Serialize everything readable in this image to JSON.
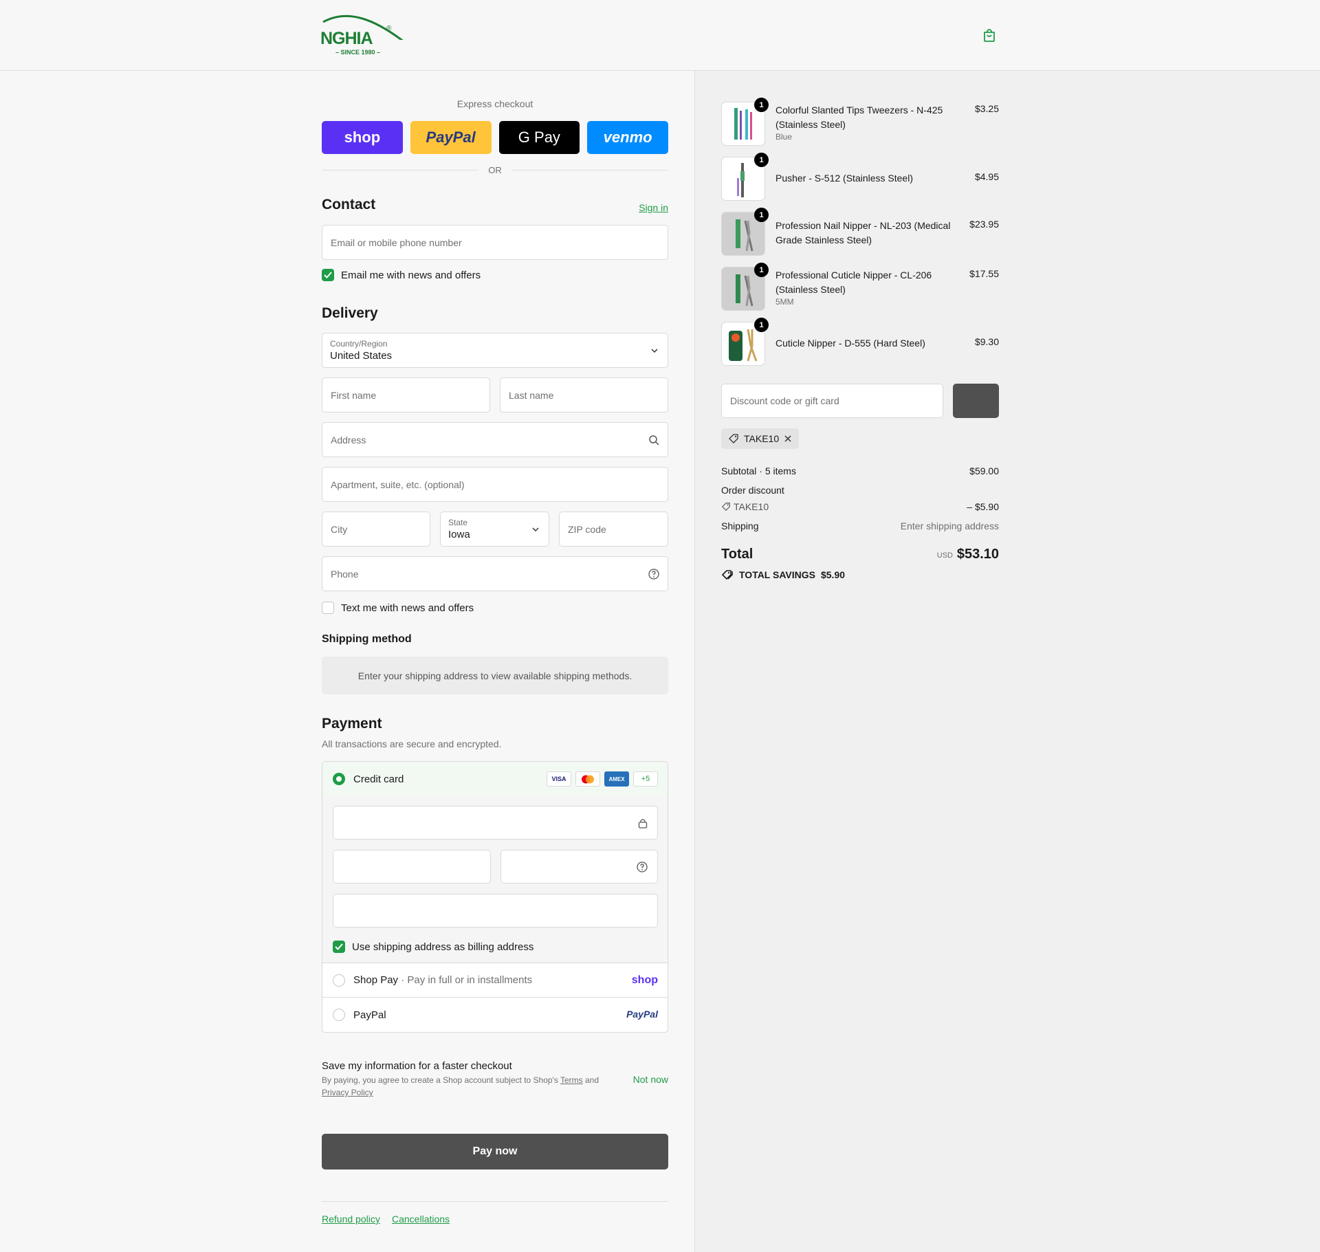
{
  "brand": {
    "logo_text": "NGHIA",
    "since": "– SINCE 1980 –",
    "reg": "®"
  },
  "express": {
    "title": "Express checkout",
    "buttons": [
      "shop",
      "PayPal",
      "G Pay",
      "venmo"
    ],
    "or": "OR"
  },
  "contact": {
    "title": "Contact",
    "sign_in": "Sign in",
    "email_placeholder": "Email or mobile phone number",
    "news_label": "Email me with news and offers"
  },
  "delivery": {
    "title": "Delivery",
    "country_label": "Country/Region",
    "country_value": "United States",
    "first_name": "First name",
    "last_name": "Last name",
    "address": "Address",
    "apartment": "Apartment, suite, etc. (optional)",
    "city": "City",
    "state_label": "State",
    "state_value": "Iowa",
    "zip": "ZIP code",
    "phone": "Phone",
    "text_label": "Text me with news and offers"
  },
  "shipping": {
    "title": "Shipping method",
    "notice": "Enter your shipping address to view available shipping methods."
  },
  "payment": {
    "title": "Payment",
    "subtitle": "All transactions are secure and encrypted.",
    "credit_card": "Credit card",
    "badges": [
      "VISA",
      "",
      "AMEX",
      "+5"
    ],
    "billing_label": "Use shipping address as billing address",
    "shop_pay": "Shop Pay",
    "shop_pay_sub": "Pay in full or in installments",
    "shop_brand": "shop",
    "paypal": "PayPal",
    "paypal_brand": "PayPal"
  },
  "save": {
    "title": "Save my information for a faster checkout",
    "sub_1": "By paying, you agree to create a Shop account subject to Shop's ",
    "terms": "Terms",
    "and": " and",
    "privacy": "Privacy Policy",
    "not_now": "Not now"
  },
  "pay_now": "Pay now",
  "footer": {
    "refund": "Refund policy",
    "cancellations": "Cancellations"
  },
  "items": [
    {
      "qty": "1",
      "name_1": "Colorful Slanted Tips Tweezers - N-425",
      "name_2": "(Stainless Steel)",
      "variant": "Blue",
      "price": "$3.25"
    },
    {
      "qty": "1",
      "name_1": "Pusher - S-512 (Stainless Steel)",
      "name_2": "",
      "variant": "",
      "price": "$4.95"
    },
    {
      "qty": "1",
      "name_1": "Profession Nail Nipper - NL-203 (Medical",
      "name_2": "Grade Stainless Steel)",
      "variant": "",
      "price": "$23.95"
    },
    {
      "qty": "1",
      "name_1": "Professional Cuticle Nipper - CL-206",
      "name_2": "(Stainless Steel)",
      "variant": "5MM",
      "price": "$17.55"
    },
    {
      "qty": "1",
      "name_1": "Cuticle Nipper - D-555 (Hard Steel)",
      "name_2": "",
      "variant": "",
      "price": "$9.30"
    }
  ],
  "discount": {
    "placeholder": "Discount code or gift card",
    "chip": "TAKE10"
  },
  "summary": {
    "subtotal_label": "Subtotal · 5 items",
    "subtotal": "$59.00",
    "order_discount": "Order discount",
    "code": "TAKE10",
    "discount_value": "– $5.90",
    "shipping_label": "Shipping",
    "shipping_value": "Enter shipping address",
    "total_label": "Total",
    "currency": "USD",
    "total": "$53.10",
    "savings_label": "TOTAL SAVINGS",
    "savings": "$5.90"
  },
  "colors": {
    "accent": "#1e9c47",
    "shop": "#5a31f4",
    "paypal": "#ffc439",
    "venmo": "#008cff",
    "button_dark": "#505050"
  }
}
